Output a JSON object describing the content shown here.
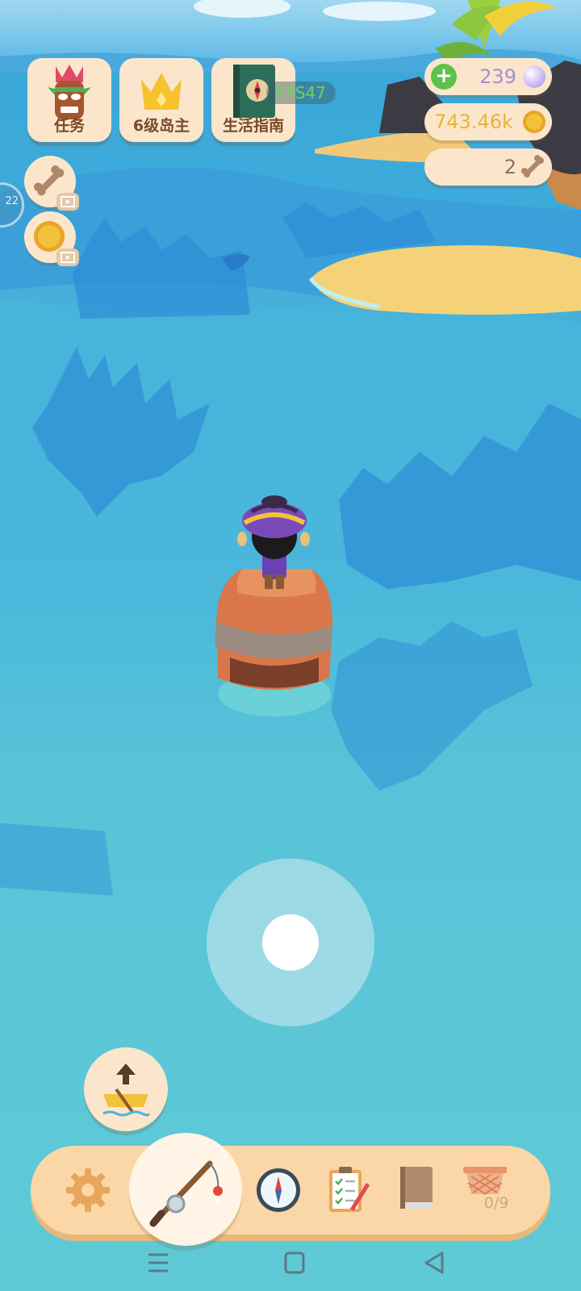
{
  "hud": {
    "task_label": "任务",
    "level_label": "6级岛主",
    "guide_label": "生活指南",
    "fps": "FPS47"
  },
  "resources": {
    "pearls": "239",
    "coins": "743.46k",
    "bones": "2"
  },
  "side_buttons": {
    "edge_counter": "22"
  },
  "toolbar": {
    "basket_count": "0/9",
    "items": [
      "settings-icon",
      "fishing-rod-icon",
      "compass-icon",
      "checklist-icon",
      "book-icon",
      "basket-icon"
    ]
  },
  "colors": {
    "card_bg": "#fbe6cc",
    "label_brown": "#7a4a2a",
    "pearl_purple": "#a08de0",
    "coin_gold": "#e8b43a",
    "bone_brown": "#8a7060",
    "fps_green": "#6fd35a",
    "water": "#5ec6d8"
  }
}
